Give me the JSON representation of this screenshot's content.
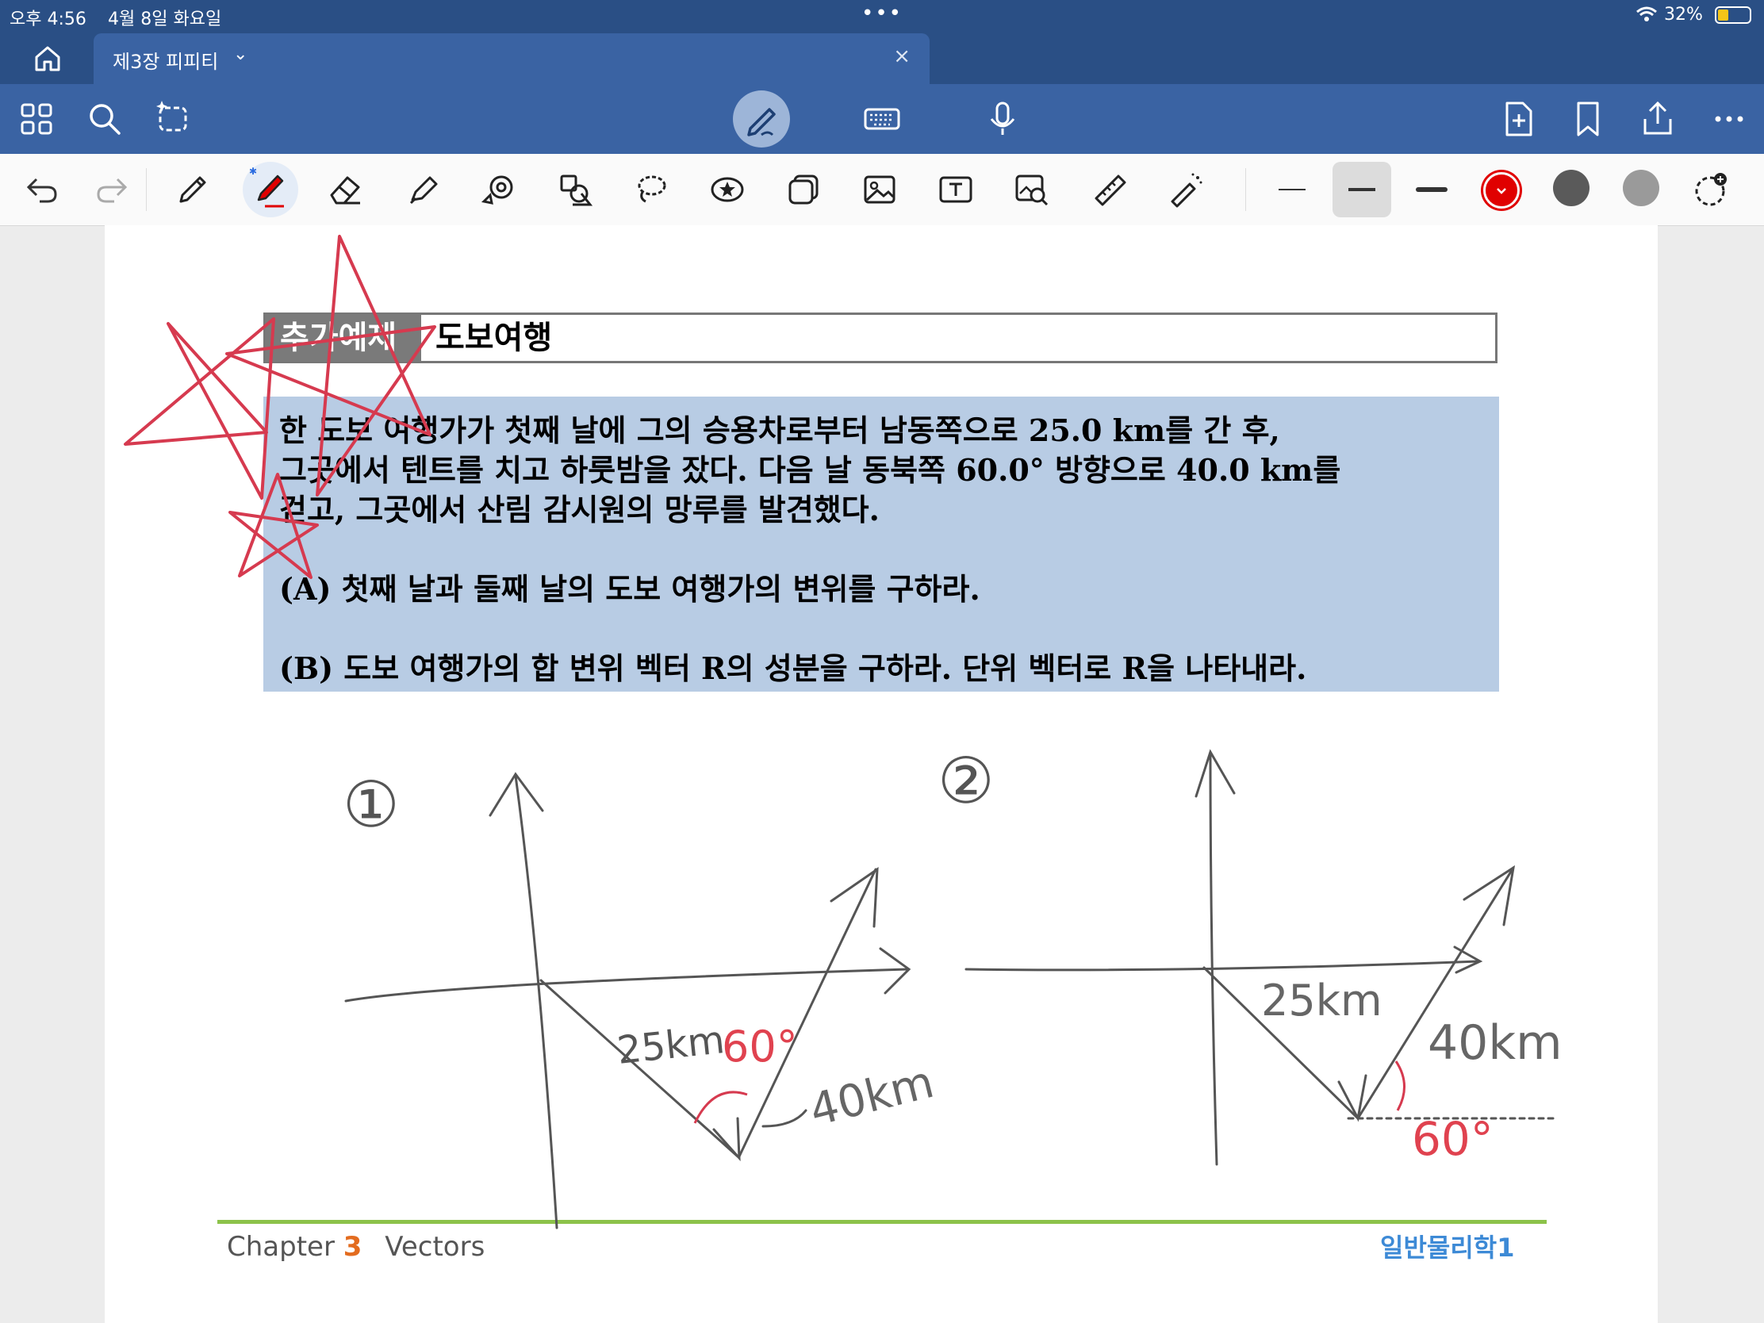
{
  "status": {
    "time": "오후 4:56",
    "date": "4월 8일 화요일",
    "battery": "32%"
  },
  "tab": {
    "title": "제3장 피피티"
  },
  "page": {
    "tag": "추가예제",
    "title": "도보여행",
    "problem_lines": [
      "한 도보 여행가가 첫째 날에 그의 승용차로부터 남동쪽으로 25.0 km를 간 후,",
      "그곳에서 텐트를 치고 하룻밤을 잤다. 다음 날 동북쪽 60.0° 방향으로 40.0 km를",
      "걷고, 그곳에서 산림 감시원의 망루를 발견했다.",
      "(A) 첫째 날과 둘째 날의 도보 여행가의 변위를 구하라.",
      "(B) 도보 여행가의 합 변위 벡터 R의 성분을 구하라. 단위 벡터로 R을 나타내라."
    ],
    "footer_chapter_word": "Chapter",
    "footer_chapter_num": "3",
    "footer_chapter_name": "Vectors",
    "footer_right": "일반물리학1"
  },
  "ink": {
    "label1": "①",
    "label2": "②",
    "d1_a": "25km",
    "d1_b": "40km",
    "d1_angle": "60°",
    "d2_a": "25km",
    "d2_b": "40km",
    "d2_angle": "60°"
  },
  "colors": {
    "header_dark": "#2a4f85",
    "header": "#3a63a3",
    "problem_bg": "#b8cce4",
    "ink_red": "#d63a4f",
    "pen_red": "#e00000",
    "footer_line": "#8cc24a",
    "footer_orange": "#e36c1f",
    "footer_blue": "#3d8ad6"
  }
}
